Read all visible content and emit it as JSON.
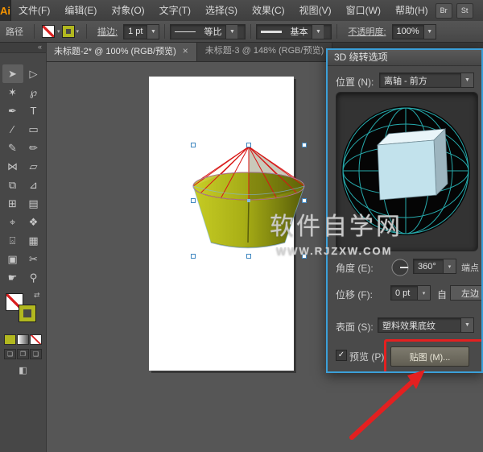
{
  "colors": {
    "accent_blue": "#3b9fd8",
    "highlight_red": "#e42020",
    "cone_yellow": "#b2b81f",
    "wire_red": "#dd1111",
    "cube_teal": "#2cc7ca"
  },
  "menubar": {
    "logo": "Ai",
    "items": [
      {
        "name": "menu-file",
        "label": "文件(F)"
      },
      {
        "name": "menu-edit",
        "label": "编辑(E)"
      },
      {
        "name": "menu-object",
        "label": "对象(O)"
      },
      {
        "name": "menu-type",
        "label": "文字(T)"
      },
      {
        "name": "menu-select",
        "label": "选择(S)"
      },
      {
        "name": "menu-effect",
        "label": "效果(C)"
      },
      {
        "name": "menu-view",
        "label": "视图(V)"
      },
      {
        "name": "menu-window",
        "label": "窗口(W)"
      },
      {
        "name": "menu-help",
        "label": "帮助(H)"
      }
    ],
    "right_buttons": [
      {
        "name": "bridge-button",
        "label": "Br"
      },
      {
        "name": "stock-button",
        "label": "St"
      }
    ]
  },
  "controlbar": {
    "panel_label": "路径",
    "stroke_label": "描边:",
    "stroke_width": "1 pt",
    "profile_label": "等比",
    "brush_label": "基本",
    "opacity_label": "不透明度:",
    "opacity_value": "100%"
  },
  "toolbar": {
    "tools": [
      {
        "name": "selection-tool-icon",
        "glyph": "➤"
      },
      {
        "name": "direct-selection-tool-icon",
        "glyph": "▷"
      },
      {
        "name": "magic-wand-tool-icon",
        "glyph": "✶"
      },
      {
        "name": "lasso-tool-icon",
        "glyph": "℘"
      },
      {
        "name": "pen-tool-icon",
        "glyph": "✒"
      },
      {
        "name": "type-tool-icon",
        "glyph": "T"
      },
      {
        "name": "line-tool-icon",
        "glyph": "∕"
      },
      {
        "name": "rectangle-tool-icon",
        "glyph": "▭"
      },
      {
        "name": "paintbrush-tool-icon",
        "glyph": "✎"
      },
      {
        "name": "pencil-tool-icon",
        "glyph": "✏"
      },
      {
        "name": "width-tool-icon",
        "glyph": "⋈"
      },
      {
        "name": "free-transform-tool-icon",
        "glyph": "▱"
      },
      {
        "name": "shape-builder-tool-icon",
        "glyph": "⧉"
      },
      {
        "name": "perspective-grid-tool-icon",
        "glyph": "⊿"
      },
      {
        "name": "mesh-tool-icon",
        "glyph": "⊞"
      },
      {
        "name": "gradient-tool-icon",
        "glyph": "▤"
      },
      {
        "name": "eyedropper-tool-icon",
        "glyph": "⌖"
      },
      {
        "name": "blend-tool-icon",
        "glyph": "❖"
      },
      {
        "name": "symbol-sprayer-tool-icon",
        "glyph": "⌺"
      },
      {
        "name": "column-graph-tool-icon",
        "glyph": "▦"
      },
      {
        "name": "artboard-tool-icon",
        "glyph": "▣"
      },
      {
        "name": "slice-tool-icon",
        "glyph": "✂"
      },
      {
        "name": "hand-tool-icon",
        "glyph": "☛"
      },
      {
        "name": "zoom-tool-icon",
        "glyph": "⚲"
      }
    ]
  },
  "tabs": [
    {
      "label": "未标题-2* @ 100% (RGB/预览)",
      "close": "×"
    },
    {
      "label": "未标题-3 @ 148% (RGB/预览)"
    }
  ],
  "dialog": {
    "title": "3D 绕转选项",
    "position_label": "位置 (N):",
    "position_value": "离轴 - 前方",
    "angle_label": "角度 (E):",
    "angle_value": "360°",
    "endpoints_label": "端点",
    "offset_label": "位移 (F):",
    "offset_value": "0 pt",
    "offset_from": "自",
    "offset_edge": "左边",
    "surface_label": "表面 (S):",
    "surface_value": "塑料效果底纹",
    "preview_label": "预览 (P)",
    "map_button": "贴图 (M)..."
  },
  "watermark": {
    "line1": "软件自学网",
    "line2": "WWW.RJZXW.COM"
  },
  "icons": {
    "dropdown": "▼",
    "small_arrow": "▾",
    "check": "✓",
    "swap": "⇄",
    "collapse": "«",
    "screen_mode": "◧",
    "draw_normal": "❏",
    "draw_behind": "❐",
    "draw_inside": "❑"
  }
}
